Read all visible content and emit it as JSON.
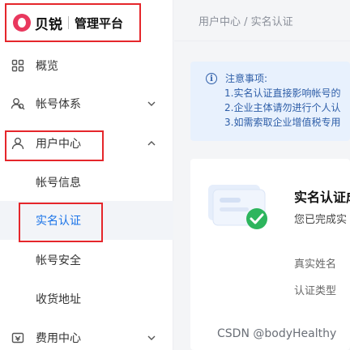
{
  "brand": {
    "name": "贝锐",
    "subtitle": "管理平台"
  },
  "sidebar": {
    "items": [
      {
        "label": "概览",
        "icon": "grid-icon"
      },
      {
        "label": "帐号体系",
        "icon": "users-icon",
        "arrow": "chevron-down"
      },
      {
        "label": "用户中心",
        "icon": "user-icon",
        "arrow": "chevron-up"
      },
      {
        "label": "费用中心",
        "icon": "wallet-icon",
        "arrow": "chevron-down"
      }
    ],
    "submenu": [
      {
        "label": "帐号信息"
      },
      {
        "label": "实名认证",
        "active": true
      },
      {
        "label": "帐号安全"
      },
      {
        "label": "收货地址"
      }
    ]
  },
  "breadcrumb": "用户中心 / 实名认证",
  "notice": {
    "title": "注意事项:",
    "lines": [
      "1.实名认证直接影响帐号的",
      "2.企业主体请勿进行个人认",
      "3.如需索取企业增值税专用"
    ]
  },
  "card": {
    "title": "实名认证成",
    "desc": "您已完成实",
    "fields": [
      "真实姓名",
      "认证类型"
    ]
  },
  "watermark": "CSDN @bodyHealthy",
  "colors": {
    "accent": "#1a73e8",
    "highlight": "#e5262b",
    "notice_bg": "#e8f1fd",
    "success": "#2db55d"
  }
}
